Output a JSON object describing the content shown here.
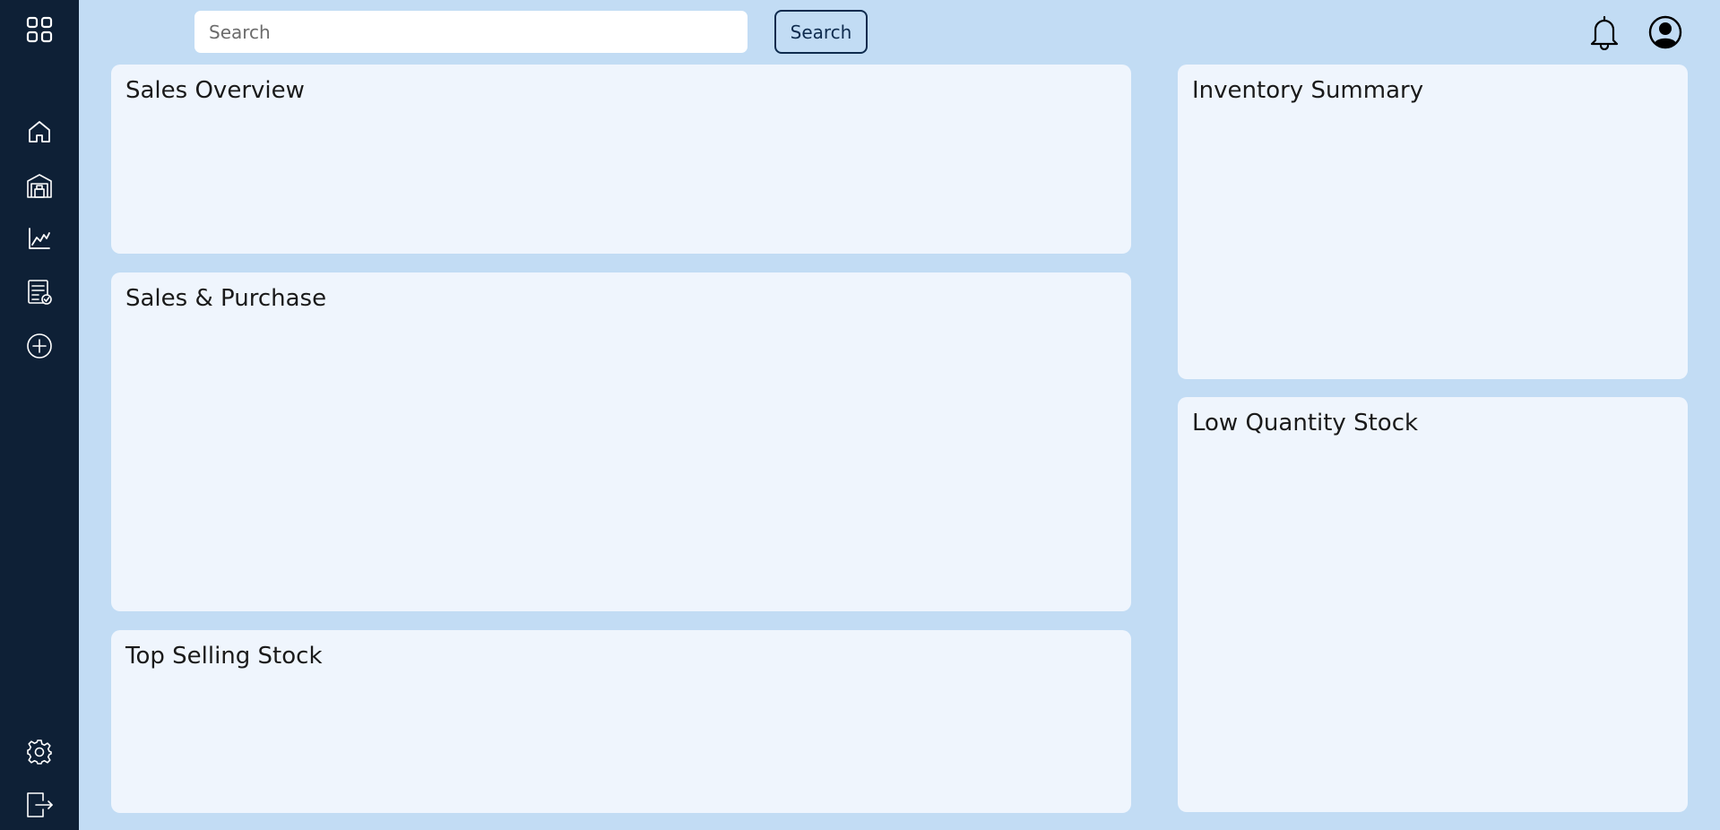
{
  "sidebar": {
    "items": [
      {
        "icon": "grid-icon"
      },
      {
        "icon": "home-icon"
      },
      {
        "icon": "warehouse-icon"
      },
      {
        "icon": "chart-icon"
      },
      {
        "icon": "report-icon"
      },
      {
        "icon": "add-circle-icon"
      },
      {
        "icon": "gear-icon"
      },
      {
        "icon": "logout-icon"
      }
    ]
  },
  "header": {
    "search_placeholder": "Search",
    "search_button_label": "Search",
    "icons": [
      "bell-icon",
      "user-icon"
    ]
  },
  "cards": {
    "sales_overview": "Sales Overview",
    "sales_purchase": "Sales & Purchase",
    "top_selling": "Top Selling Stock",
    "inventory_summary": "Inventory Summary",
    "low_quantity": "Low Quantity Stock"
  },
  "colors": {
    "sidebar": "#0e2036",
    "background": "#c2dcf4",
    "card": "#eff5fd",
    "accent": "#0e2b4e"
  }
}
